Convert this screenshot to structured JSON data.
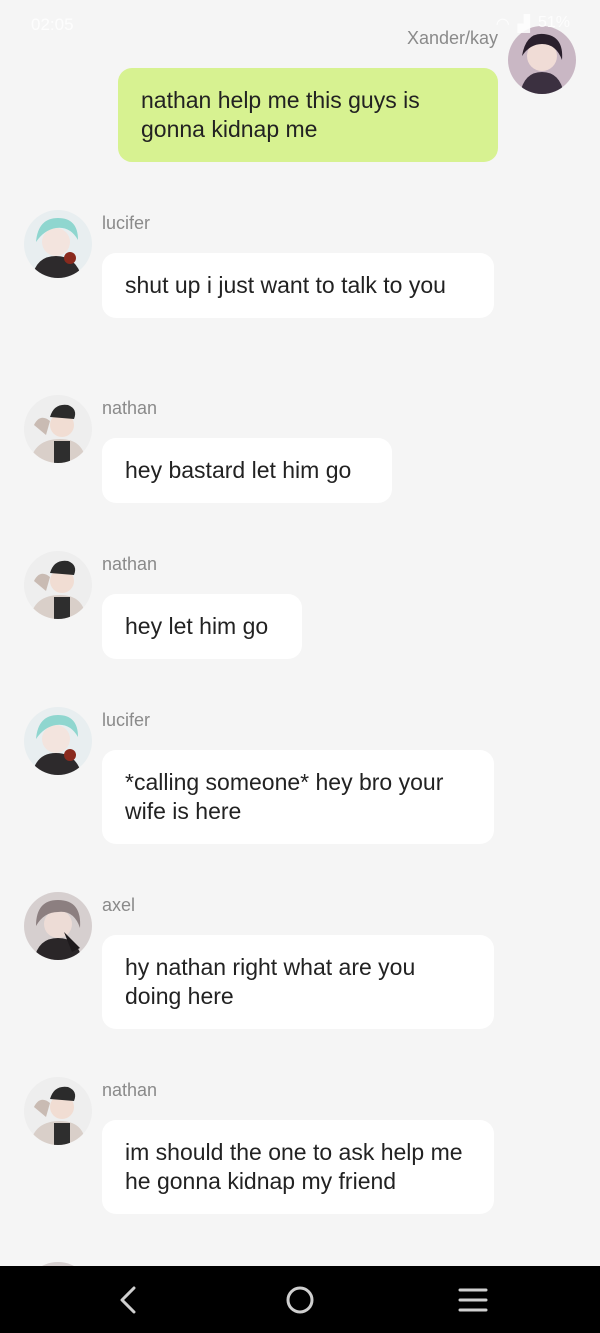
{
  "status_bar": {
    "time": "02:05",
    "battery": "51%"
  },
  "messages": [
    {
      "sender": "Xander/kay",
      "text": "nathan help me this guys is gonna kidnap me",
      "self": true,
      "avatar": "xander-avatar"
    },
    {
      "sender": "lucifer",
      "text": "shut up i just want to talk to you",
      "self": false,
      "avatar": "lucifer-avatar"
    },
    {
      "sender": "nathan",
      "text": "hey bastard let him go",
      "self": false,
      "avatar": "nathan-avatar"
    },
    {
      "sender": "nathan",
      "text": "hey let him go",
      "self": false,
      "avatar": "nathan-avatar"
    },
    {
      "sender": "lucifer",
      "text": "*calling someone* hey bro your wife is here",
      "self": false,
      "avatar": "lucifer-avatar"
    },
    {
      "sender": "axel",
      "text": "hy nathan right what are you doing here",
      "self": false,
      "avatar": "axel-avatar"
    },
    {
      "sender": "nathan",
      "text": "im should the one  to ask  help me he gonna kidnap my friend",
      "self": false,
      "avatar": "nathan-avatar"
    }
  ],
  "nav": {
    "back": "back-icon",
    "home": "home-icon",
    "menu": "menu-icon"
  },
  "colors": {
    "self_bubble": "#d7f291",
    "other_bubble": "#ffffff",
    "background": "#f5f5f5",
    "nav_bar": "#000000"
  }
}
